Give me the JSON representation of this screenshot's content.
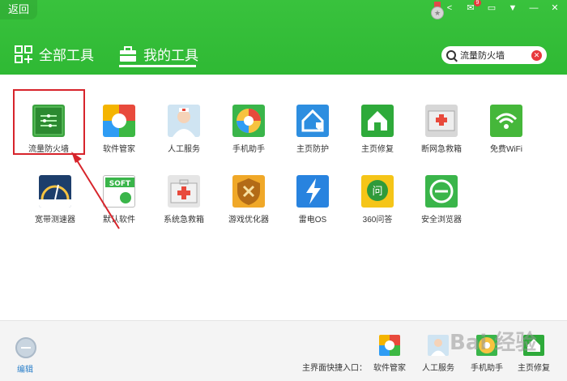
{
  "header": {
    "back_label": "返回",
    "tabs": [
      {
        "label": "全部工具",
        "icon": "grid-plus-icon"
      },
      {
        "label": "我的工具",
        "icon": "toolbox-icon",
        "active": true
      }
    ],
    "badge_count": "9",
    "search": {
      "value": "流量防火墙",
      "placeholder": ""
    }
  },
  "tools_row1": [
    {
      "label": "流量防火墙",
      "icon": "firewall-icon"
    },
    {
      "label": "软件管家",
      "icon": "software-manager-icon"
    },
    {
      "label": "人工服务",
      "icon": "doctor-service-icon"
    },
    {
      "label": "手机助手",
      "icon": "phone-assistant-icon"
    },
    {
      "label": "主页防护",
      "icon": "homepage-protect-icon"
    },
    {
      "label": "主页修复",
      "icon": "homepage-repair-icon"
    },
    {
      "label": "断网急救箱",
      "icon": "network-firstaid-icon"
    },
    {
      "label": "免费WiFi",
      "icon": "wifi-icon"
    }
  ],
  "tools_row2": [
    {
      "label": "宽带测速器",
      "icon": "speedometer-icon"
    },
    {
      "label": "默认软件",
      "icon": "soft-default-icon"
    },
    {
      "label": "系统急救箱",
      "icon": "system-firstaid-icon"
    },
    {
      "label": "游戏优化器",
      "icon": "game-optimizer-icon"
    },
    {
      "label": "雷电OS",
      "icon": "thunder-os-icon"
    },
    {
      "label": "360问答",
      "icon": "qa-icon"
    },
    {
      "label": "安全浏览器",
      "icon": "browser-icon"
    }
  ],
  "bottom": {
    "edit_label": "编辑",
    "quick_entry_label": "主界面快捷入口：",
    "quick_items": [
      {
        "label": "软件管家",
        "icon": "software-manager-icon"
      },
      {
        "label": "人工服务",
        "icon": "doctor-service-icon"
      },
      {
        "label": "手机助手",
        "icon": "phone-assistant-icon"
      },
      {
        "label": "主页修复",
        "icon": "homepage-repair-icon"
      }
    ]
  },
  "colors": {
    "header_green": "#32bb36",
    "highlight_red": "#d7242b",
    "accent_blue": "#2a7fc9"
  }
}
